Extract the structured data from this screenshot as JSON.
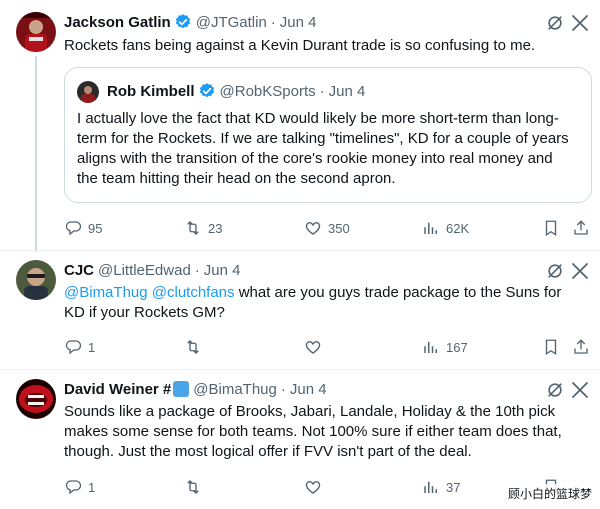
{
  "tweets": [
    {
      "name": "Jackson Gatlin",
      "verified": true,
      "handle": "@JTGatlin",
      "date": "Jun 4",
      "text": "Rockets fans being against a Kevin Durant trade is so confusing to me.",
      "quote": {
        "name": "Rob Kimbell",
        "verified": true,
        "handle": "@RobKSports",
        "date": "Jun 4",
        "text": "I actually love the fact that KD would likely be more short-term than long-term for the Rockets. If we are talking \"timelines\", KD for a couple of years aligns with the transition of the core's rookie money into real money and the team hitting their head on the second apron."
      },
      "replies": "95",
      "reposts": "23",
      "likes": "350",
      "views": "62K"
    },
    {
      "name": "CJC",
      "handle": "@LittleEdwad",
      "date": "Jun 4",
      "mention_1": "@BimaThug",
      "mention_2": "@clutchfans",
      "text_rest": " what are you guys trade package to the Suns for KD if your Rockets GM?",
      "replies": "1",
      "reposts": "",
      "likes": "",
      "views": "167"
    },
    {
      "name": "David Weiner #",
      "handle": "@BimaThug",
      "date": "Jun 4",
      "text": "Sounds like a package of Brooks, Jabari, Landale, Holiday & the 10th pick makes some sense for both teams. Not 100% sure if either team does that, though. Just the most logical offer if FVV isn't part of the deal.",
      "replies": "1",
      "reposts": "",
      "likes": "",
      "views": "37"
    }
  ],
  "colors": {
    "accent": "#1d9bf0",
    "secondary_text": "#536471",
    "border": "#cfd9de",
    "divider": "#eff3f4"
  },
  "icons": [
    "grok-icon",
    "more-icon",
    "reply-icon",
    "repost-icon",
    "like-icon",
    "views-icon",
    "bookmark-icon",
    "share-icon",
    "verified-icon",
    "blue-square-emoji"
  ],
  "watermark": "顾小白的篮球梦"
}
